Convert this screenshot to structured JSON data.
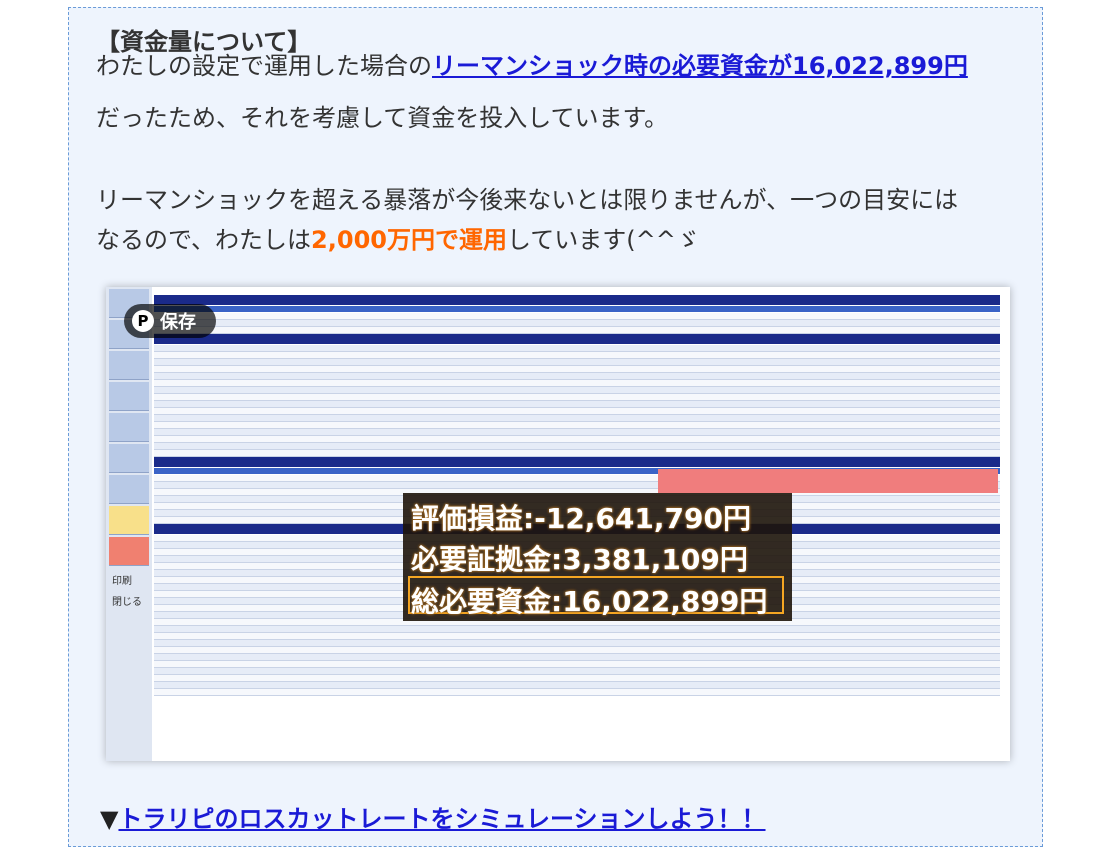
{
  "article": {
    "heading": "【資金量について】",
    "para1_prefix": "わたしの設定で運用した場合の",
    "para1_link": "リーマンショック時の必要資金が16,022,899円",
    "para1_line2": "だったため、それを考慮して資金を投入しています。",
    "para2_line1": "リーマンショックを超える暴落が今後来ないとは限りませんが、一つの目安には",
    "para2_prefix": "なるので、わたしは",
    "para2_highlight": "2,000万円で運用",
    "para2_suffix": "しています(^^ゞ"
  },
  "screenshot": {
    "pin_button": {
      "icon": "pinterest-icon",
      "label": "保存"
    },
    "sidebar_labels": [
      "印刷",
      "閉じる"
    ],
    "overlay": {
      "line1_label": "評価損益",
      "line1_value": "-12,641,790円",
      "line2_label": "必要証拠金",
      "line2_value": "3,381,109円",
      "line3_label": "総必要資金",
      "line3_value": "16,022,899円",
      "separator": ":"
    }
  },
  "footer_link": {
    "prefix": "▼",
    "text": "トラリピのロスカットレートをシミュレーションしよう！！"
  },
  "colors": {
    "link": "#1a1ad6",
    "highlight": "#ff6600",
    "panel": "#eef4fd",
    "border": "#6a9bd8"
  }
}
